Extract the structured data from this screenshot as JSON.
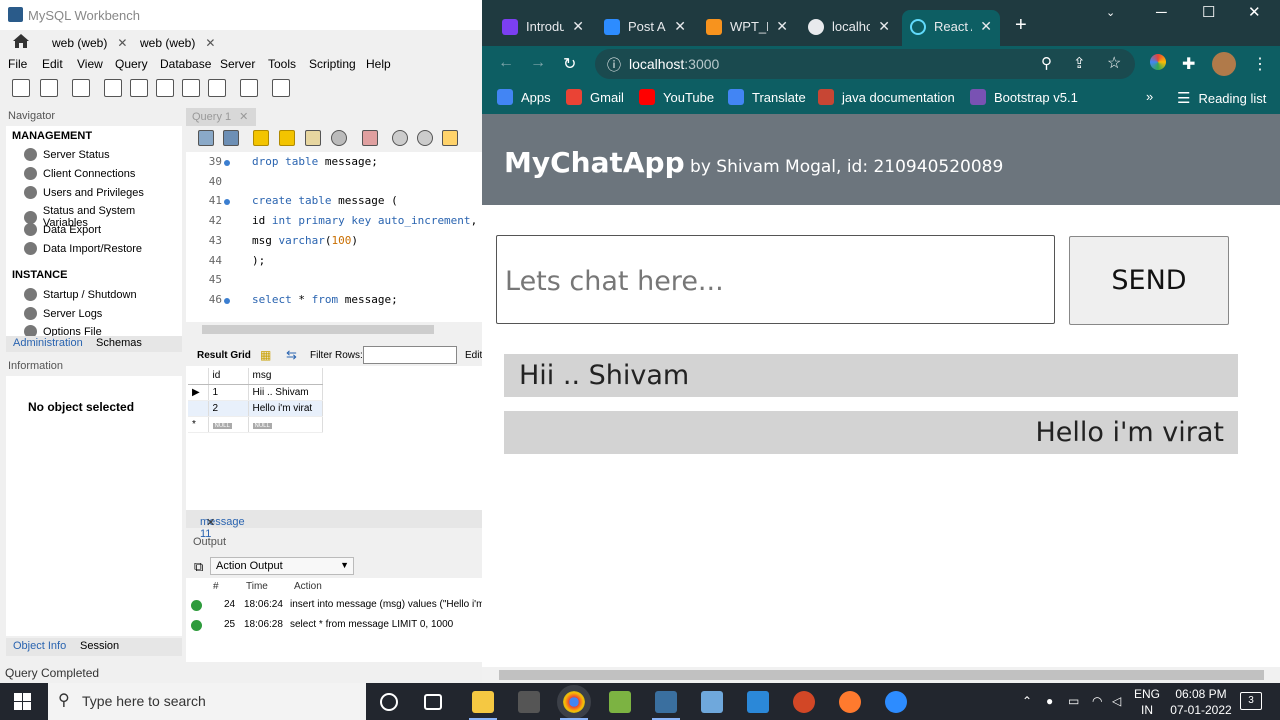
{
  "workbench": {
    "title": "MySQL Workbench",
    "conn_tabs": [
      "web (web)",
      "web (web)"
    ],
    "menu": [
      "File",
      "Edit",
      "View",
      "Query",
      "Database",
      "Server",
      "Tools",
      "Scripting",
      "Help"
    ],
    "navigator_label": "Navigator",
    "management_label": "MANAGEMENT",
    "management_items": [
      "Server Status",
      "Client Connections",
      "Users and Privileges",
      "Status and System Variables",
      "Data Export",
      "Data Import/Restore"
    ],
    "instance_label": "INSTANCE",
    "instance_items": [
      "Startup / Shutdown",
      "Server Logs",
      "Options File"
    ],
    "nav_tabs": [
      "Administration",
      "Schemas"
    ],
    "information_label": "Information",
    "no_object": "No object selected",
    "info_tabs": [
      "Object Info",
      "Session"
    ],
    "query_tab": "Query 1",
    "status": "Query Completed",
    "editor_lines": [
      {
        "n": "39",
        "dot": true,
        "code": [
          {
            "t": "drop table",
            "c": "kw"
          },
          {
            "t": " message;",
            "c": ""
          }
        ]
      },
      {
        "n": "40",
        "dot": false,
        "code": []
      },
      {
        "n": "41",
        "dot": true,
        "code": [
          {
            "t": "create table",
            "c": "kw"
          },
          {
            "t": " message (",
            "c": ""
          }
        ]
      },
      {
        "n": "42",
        "dot": false,
        "code": [
          {
            "t": "id ",
            "c": ""
          },
          {
            "t": "int primary key auto_increment",
            "c": "kw"
          },
          {
            "t": ",",
            "c": ""
          }
        ]
      },
      {
        "n": "43",
        "dot": false,
        "code": [
          {
            "t": "msg ",
            "c": ""
          },
          {
            "t": "varchar",
            "c": "kw"
          },
          {
            "t": "(",
            "c": ""
          },
          {
            "t": "100",
            "c": "num"
          },
          {
            "t": ")",
            "c": ""
          }
        ]
      },
      {
        "n": "44",
        "dot": false,
        "code": [
          {
            "t": ");",
            "c": ""
          }
        ]
      },
      {
        "n": "45",
        "dot": false,
        "code": []
      },
      {
        "n": "46",
        "dot": true,
        "code": [
          {
            "t": "select",
            "c": "kw"
          },
          {
            "t": " * ",
            "c": ""
          },
          {
            "t": "from",
            "c": "kw"
          },
          {
            "t": " message;",
            "c": ""
          }
        ]
      }
    ],
    "result_grid_label": "Result Grid",
    "filter_rows_label": "Filter Rows:",
    "edit_label": "Edit",
    "grid_columns": [
      "id",
      "msg"
    ],
    "grid_rows": [
      [
        "1",
        "Hii .. Shivam"
      ],
      [
        "2",
        "Hello i'm virat"
      ]
    ],
    "null_tag": "NULL",
    "message_tab": "message 11",
    "output_label": "Output",
    "output_select": "Action Output",
    "output_columns": [
      "#",
      "Time",
      "Action"
    ],
    "output_rows": [
      {
        "num": "24",
        "time": "18:06:24",
        "action": "insert into message (msg) values (\"Hello i'm"
      },
      {
        "num": "25",
        "time": "18:06:28",
        "action": "select * from message LIMIT 0, 1000"
      }
    ]
  },
  "chrome": {
    "tabs": [
      {
        "label": "Introdu",
        "color": "#7b3ff2"
      },
      {
        "label": "Post A",
        "color": "#2d8cff"
      },
      {
        "label": "WPT_F",
        "color": "#f7931e"
      },
      {
        "label": "localho",
        "color": "#e8eaed"
      },
      {
        "label": "React A",
        "color": "#61dafb"
      }
    ],
    "url_host": "localhost",
    "url_port": ":3000",
    "bookmarks": [
      {
        "label": "Apps",
        "color": "#4285f4"
      },
      {
        "label": "Gmail",
        "color": "#ea4335"
      },
      {
        "label": "YouTube",
        "color": "#ff0000"
      },
      {
        "label": "Translate",
        "color": "#4285f4"
      },
      {
        "label": "java documentation",
        "color": "#c74634"
      },
      {
        "label": "Bootstrap v5.1",
        "color": "#7952b3"
      }
    ],
    "more_bookmarks": "»",
    "reading_list": "Reading list"
  },
  "app": {
    "brand": "MyChatApp",
    "byline": " by Shivam Mogal, id: 210940520089",
    "input_placeholder": "Lets chat here...",
    "send_label": "SEND",
    "messages": [
      {
        "text": "Hii .. Shivam",
        "align": "left"
      },
      {
        "text": "Hello i'm virat",
        "align": "right"
      }
    ]
  },
  "taskbar": {
    "search_placeholder": "Type here to search",
    "lang_top": "ENG",
    "lang_bottom": "IN",
    "time": "06:08 PM",
    "date": "07-01-2022",
    "notification_count": "3"
  }
}
